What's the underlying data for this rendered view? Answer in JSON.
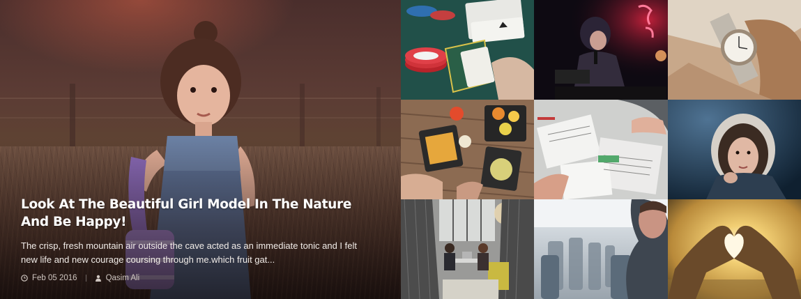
{
  "featured": {
    "title": "Look At The Beautiful Girl Model In The Nature And Be Happy!",
    "excerpt": "The crisp, fresh mountain air outside the cave acted as an immediate tonic and I felt new life and new courage coursing through me.which fruit gat...",
    "date": "Feb 05 2016",
    "author": "Qasim Ali",
    "date_icon": "clock-icon",
    "author_icon": "user-icon"
  },
  "tiles": [
    {
      "subject": "poker cards and chips",
      "icon": "poker-image"
    },
    {
      "subject": "singer at concert",
      "icon": "concert-image"
    },
    {
      "subject": "wrist watch",
      "icon": "watch-image"
    },
    {
      "subject": "food on table",
      "icon": "food-image"
    },
    {
      "subject": "people working on papers",
      "icon": "desk-image"
    },
    {
      "subject": "woman in winter hood",
      "icon": "winter-portrait-image"
    },
    {
      "subject": "office lounge booths",
      "icon": "office-image"
    },
    {
      "subject": "man in train",
      "icon": "train-image"
    },
    {
      "subject": "heart hands at sunset",
      "icon": "heart-hands-image"
    }
  ]
}
